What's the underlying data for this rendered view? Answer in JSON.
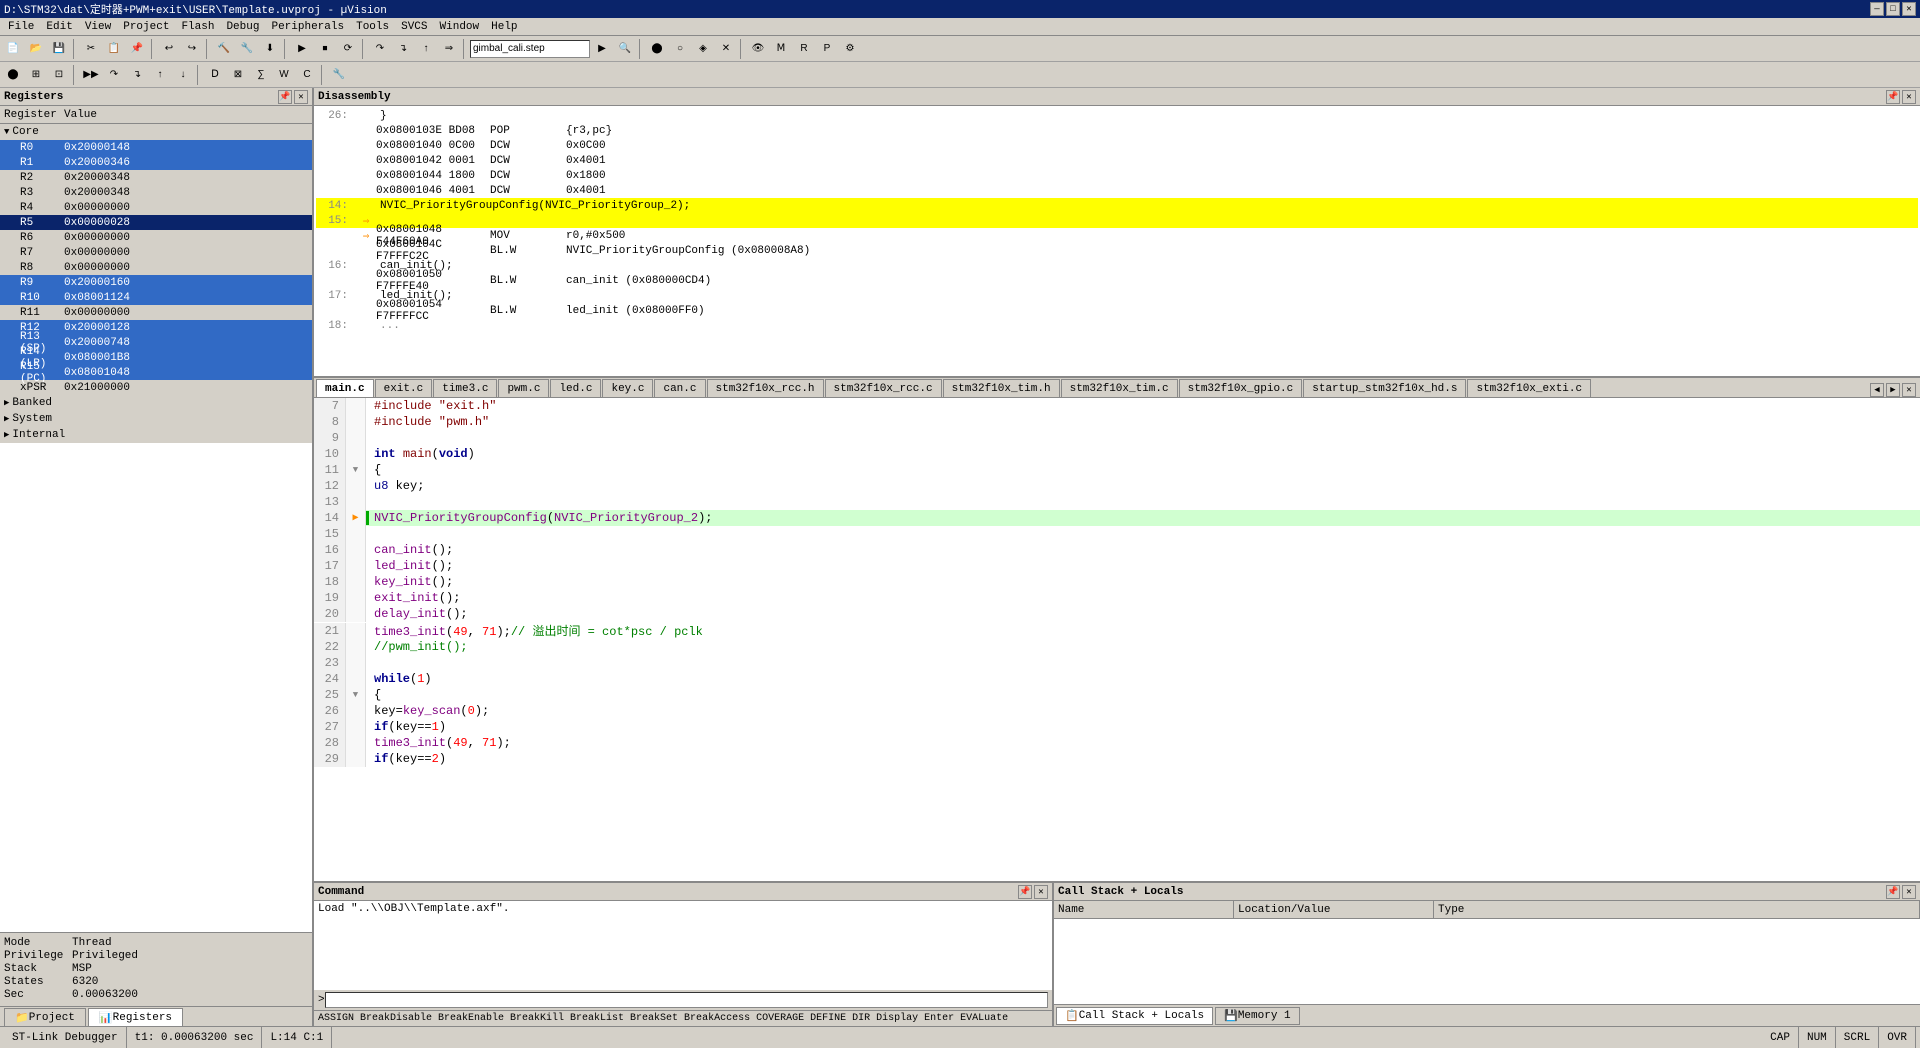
{
  "titlebar": {
    "title": "D:\\STM32\\dat\\定时器+PWM+exit\\USER\\Template.uvproj - µVision",
    "minimize": "—",
    "maximize": "□",
    "close": "✕"
  },
  "menus": [
    "File",
    "Edit",
    "View",
    "Project",
    "Flash",
    "Debug",
    "Peripherals",
    "Tools",
    "SVCS",
    "Window",
    "Help"
  ],
  "toolbar2_input": "gimbal_cali.step",
  "panels": {
    "registers": {
      "title": "Registers",
      "col_register": "Register",
      "col_value": "Value",
      "core_label": "Core",
      "registers": [
        {
          "name": "R0",
          "value": "0x20000148",
          "sel": "sel2"
        },
        {
          "name": "R1",
          "value": "0x20000346",
          "sel": "sel2"
        },
        {
          "name": "R2",
          "value": "0x20000348",
          "sel": "none"
        },
        {
          "name": "R3",
          "value": "0x20000348",
          "sel": "none"
        },
        {
          "name": "R4",
          "value": "0x00000000",
          "sel": "none"
        },
        {
          "name": "R5",
          "value": "0x00000028",
          "sel": "sel1"
        },
        {
          "name": "R6",
          "value": "0x00000000",
          "sel": "none"
        },
        {
          "name": "R7",
          "value": "0x00000000",
          "sel": "none"
        },
        {
          "name": "R8",
          "value": "0x00000000",
          "sel": "none"
        },
        {
          "name": "R9",
          "value": "0x20000160",
          "sel": "sel2"
        },
        {
          "name": "R10",
          "value": "0x08001124",
          "sel": "sel2"
        },
        {
          "name": "R11",
          "value": "0x00000000",
          "sel": "none"
        },
        {
          "name": "R12",
          "value": "0x20000128",
          "sel": "sel2"
        },
        {
          "name": "R13 (SP)",
          "value": "0x20000748",
          "sel": "sel2"
        },
        {
          "name": "R14 (LR)",
          "value": "0x080001B8",
          "sel": "sel2"
        },
        {
          "name": "R15 (PC)",
          "value": "0x08001048",
          "sel": "sel2"
        },
        {
          "name": "xPSR",
          "value": "0x21000000",
          "sel": "none"
        }
      ],
      "banked_label": "Banked",
      "system_label": "System",
      "internal_label": "Internal",
      "internal_info": {
        "mode_label": "Mode",
        "mode_value": "Thread",
        "privilege_label": "Privilege",
        "privilege_value": "Privileged",
        "stack_label": "Stack",
        "stack_value": "MSP",
        "states_label": "States",
        "states_value": "6320",
        "sec_label": "Sec",
        "sec_value": "0.00063200"
      }
    },
    "disassembly": {
      "title": "Disassembly",
      "lines": [
        {
          "num": "26:",
          "text": "}"
        },
        {
          "addr": "0x0800103E",
          "bytes": "BD08",
          "mnem": "POP",
          "operand": "{r3,pc}"
        },
        {
          "addr": "0x08001040",
          "bytes": "0C00",
          "mnem": "DCW",
          "operand": "0x0C00"
        },
        {
          "addr": "0x08001042",
          "bytes": "0001",
          "mnem": "DCW",
          "operand": "0x4001"
        },
        {
          "addr": "0x08001044",
          "bytes": "1800",
          "mnem": "DCW",
          "operand": "0x1800"
        },
        {
          "addr": "0x08001046",
          "bytes": "4001",
          "mnem": "DCW",
          "operand": "0x4001"
        },
        {
          "num": "14:",
          "text": "    NVIC_PriorityGroupConfig(NVIC_PriorityGroup_2);",
          "yellow": true
        },
        {
          "num": "15:",
          "text": "",
          "yellow": true,
          "arrow": true
        },
        {
          "addr": "0x08001048",
          "bytes": "F44F60A0",
          "mnem": "MOV",
          "operand": "r0,#0x500",
          "arrow": true
        },
        {
          "addr": "0x0800104C",
          "bytes": "F7FFFC2C",
          "mnem": "BL.W",
          "operand": "NVIC_PriorityGroupConfig (0x080008A8)"
        },
        {
          "num": "16:",
          "text": "    can_init();"
        },
        {
          "addr": "0x08001050",
          "bytes": "F7FFFE40",
          "mnem": "BL.W",
          "operand": "can_init (0x080000CD4)"
        },
        {
          "num": "17:",
          "text": "    led_init();"
        },
        {
          "addr": "0x08001054",
          "bytes": "F7FFFFCC",
          "mnem": "BL.W",
          "operand": "led_init (0x08000FF0)"
        },
        {
          "num": "18:",
          "text": "..."
        }
      ]
    },
    "code_tabs": [
      {
        "label": "main.c",
        "active": true
      },
      {
        "label": "exit.c"
      },
      {
        "label": "time3.c"
      },
      {
        "label": "pwm.c"
      },
      {
        "label": "led.c"
      },
      {
        "label": "key.c"
      },
      {
        "label": "can.c"
      },
      {
        "label": "stm32f10x_rcc.h"
      },
      {
        "label": "stm32f10x_rcc.c"
      },
      {
        "label": "stm32f10x_tim.h"
      },
      {
        "label": "stm32f10x_tim.c"
      },
      {
        "label": "stm32f10x_gpio.c"
      },
      {
        "label": "startup_stm32f10x_hd.s"
      },
      {
        "label": "stm32f10x_exti.c"
      }
    ],
    "code_lines": [
      {
        "num": 7,
        "content": "#include \"exit.h\"",
        "type": "include"
      },
      {
        "num": 8,
        "content": "#include \"pwm.h\"",
        "type": "include"
      },
      {
        "num": 9,
        "content": "",
        "type": "blank"
      },
      {
        "num": 10,
        "content": "int main(void)",
        "type": "code"
      },
      {
        "num": 11,
        "content": "{",
        "type": "code",
        "fold": true
      },
      {
        "num": 12,
        "content": "    u8 key;",
        "type": "code"
      },
      {
        "num": 13,
        "content": "",
        "type": "blank"
      },
      {
        "num": 14,
        "content": "    NVIC_PriorityGroupConfig(NVIC_PriorityGroup_2);",
        "type": "code",
        "breakpoint": true,
        "current": true
      },
      {
        "num": 15,
        "content": "",
        "type": "blank"
      },
      {
        "num": 16,
        "content": "    can_init();",
        "type": "code"
      },
      {
        "num": 17,
        "content": "    led_init();",
        "type": "code"
      },
      {
        "num": 18,
        "content": "    key_init();",
        "type": "code"
      },
      {
        "num": 19,
        "content": "    exit_init();",
        "type": "code"
      },
      {
        "num": 20,
        "content": "    delay_init();",
        "type": "code"
      },
      {
        "num": 21,
        "content": "    time3_init(49, 71);//      溢出时间 = cot*psc / pclk",
        "type": "code_comment"
      },
      {
        "num": 22,
        "content": "    //pwm_init();",
        "type": "comment"
      },
      {
        "num": 23,
        "content": "",
        "type": "blank"
      },
      {
        "num": 24,
        "content": "    while(1)",
        "type": "code"
      },
      {
        "num": 25,
        "content": "    {",
        "type": "code",
        "fold": true
      },
      {
        "num": 26,
        "content": "        key=key_scan(0);",
        "type": "code"
      },
      {
        "num": 27,
        "content": "        if(key==1)",
        "type": "code"
      },
      {
        "num": 28,
        "content": "        time3_init(49, 71);",
        "type": "code"
      },
      {
        "num": 29,
        "content": "        if(key==2)",
        "type": "code"
      }
    ],
    "command": {
      "title": "Command",
      "content": "Load \"..\\\\OBJ\\\\Template.axf\".",
      "prompt": ">"
    },
    "autocomplete": "ASSIGN BreakDisable BreakEnable BreakKill BreakList BreakSet BreakAccess COVERAGE DEFINE DIR Display Enter EVALuate",
    "callstack": {
      "title": "Call Stack + Locals",
      "col_name": "Name",
      "col_location": "Location/Value",
      "col_type": "Type",
      "tabs": [
        {
          "label": "Call Stack + Locals",
          "active": true
        },
        {
          "label": "Memory 1"
        }
      ]
    }
  },
  "status": {
    "debugger": "ST-Link Debugger",
    "time": "t1: 0.00063200 sec",
    "position": "L:14 C:1",
    "cap": "CAP",
    "num": "NUM",
    "scrl": "SCRL",
    "ovr": "OVR"
  }
}
